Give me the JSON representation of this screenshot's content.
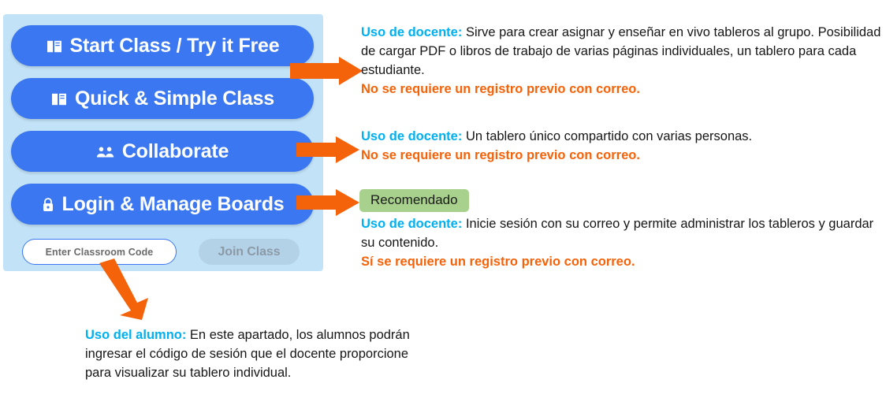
{
  "panel": {
    "name": "classroom-launch-panel",
    "background_color": "#c2e2f7",
    "buttons": [
      {
        "id": "start",
        "label": "Start Class / Try it Free",
        "icon": "book-icon"
      },
      {
        "id": "quick",
        "label": "Quick & Simple Class",
        "icon": "book-icon"
      },
      {
        "id": "collab",
        "label": "Collaborate",
        "icon": "people-icon"
      },
      {
        "id": "login",
        "label": "Login & Manage Boards",
        "icon": "lock-icon"
      }
    ],
    "button_color": "#3b77f0",
    "code_input": {
      "placeholder": "Enter Classroom Code",
      "value": ""
    },
    "join_button": {
      "label": "Join Class",
      "color": "#b3d2e8",
      "text_color": "#8b9aa6",
      "disabled": true
    }
  },
  "badge": {
    "label": "Recomendado",
    "color": "#a9d18e"
  },
  "colors": {
    "lead": "#00b0f0",
    "warn": "#f4620a",
    "arrow": "#f4620a",
    "accent_blue": "#3b77f0"
  },
  "notes": [
    {
      "id": "note-start-class",
      "lead": "Uso de docente:",
      "body": " Sirve para crear asignar y enseñar en vivo tableros al grupo. Posibilidad de cargar PDF o libros de trabajo de varias páginas individuales, un tablero para cada estudiante.",
      "warn": "No se requiere un registro previo con correo."
    },
    {
      "id": "note-collaborate",
      "lead": "Uso de docente:",
      "body": " Un tablero único compartido con varias personas.",
      "warn": "No se requiere un registro previo con correo."
    },
    {
      "id": "note-login",
      "lead": "Uso de docente:",
      "body": " Inicie sesión con su correo y permite administrar los tableros y guardar su contenido.",
      "warn": "Sí se requiere un registro previo con correo."
    },
    {
      "id": "note-student",
      "lead": "Uso del alumno:",
      "body": " En este apartado, los alumnos podrán ingresar el código de sesión que el docente proporcione para visualizar su tablero individual.",
      "warn": ""
    }
  ],
  "arrows": [
    {
      "id": "arrow-to-note-start",
      "direction": "right"
    },
    {
      "id": "arrow-to-note-collab",
      "direction": "right"
    },
    {
      "id": "arrow-to-note-login",
      "direction": "right"
    },
    {
      "id": "arrow-to-note-student",
      "direction": "down-right"
    }
  ]
}
